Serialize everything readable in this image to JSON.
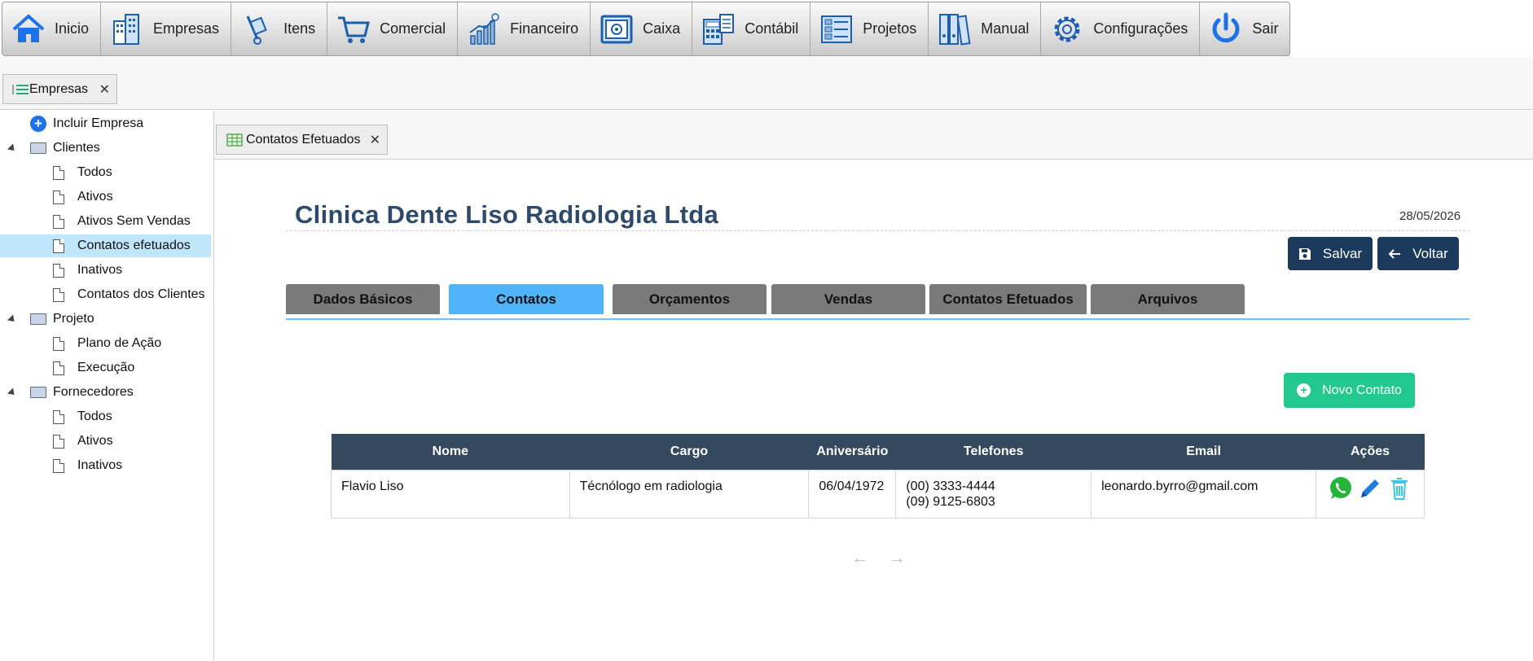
{
  "menubar": {
    "items": [
      {
        "label": "Inicio",
        "icon": "home-icon"
      },
      {
        "label": "Empresas",
        "icon": "buildings-icon"
      },
      {
        "label": "Itens",
        "icon": "hand-truck-icon"
      },
      {
        "label": "Comercial",
        "icon": "shopping-cart-icon"
      },
      {
        "label": "Financeiro",
        "icon": "finance-chart-icon"
      },
      {
        "label": "Caixa",
        "icon": "safe-icon"
      },
      {
        "label": "Contábil",
        "icon": "calculator-icon"
      },
      {
        "label": "Projetos",
        "icon": "project-board-icon"
      },
      {
        "label": "Manual",
        "icon": "binders-icon"
      },
      {
        "label": "Configurações",
        "icon": "gear-icon"
      },
      {
        "label": "Sair",
        "icon": "power-icon"
      }
    ]
  },
  "outer_tab": {
    "label": "Empresas",
    "close": "✕"
  },
  "tree": {
    "include": "Incluir Empresa",
    "groups": [
      {
        "label": "Clientes",
        "items": [
          "Todos",
          "Ativos",
          "Ativos Sem Vendas",
          "Contatos efetuados",
          "Inativos",
          "Contatos dos Clientes"
        ]
      },
      {
        "label": "Projeto",
        "items": [
          "Plano de Ação",
          "Execução"
        ]
      },
      {
        "label": "Fornecedores",
        "items": [
          "Todos",
          "Ativos",
          "Inativos"
        ]
      }
    ],
    "selected": "Contatos efetuados"
  },
  "inner_tab": {
    "label": "Contatos Efetuados",
    "close": "✕"
  },
  "page": {
    "company": "Clinica Dente Liso Radiologia Ltda",
    "date": "28/05/2026",
    "save_label": "Salvar",
    "back_label": "Voltar"
  },
  "tabs": [
    "Dados Básicos",
    "Contatos",
    "Orçamentos",
    "Vendas",
    "Contatos Efetuados",
    "Arquivos"
  ],
  "active_tab": "Contatos",
  "new_contact_label": "Novo Contato",
  "table": {
    "headers": [
      "Nome",
      "Cargo",
      "Aniversário",
      "Telefones",
      "Email",
      "Ações"
    ],
    "rows": [
      {
        "nome": "Flavio Liso",
        "cargo": "Técnólogo em radiologia",
        "aniversario": "06/04/1972",
        "telefone1": "(00) 3333-4444",
        "telefone2": "(09) 9125-6803",
        "email": "leonardo.byrro@gmail.com"
      }
    ]
  },
  "pager": {
    "prev": "←",
    "next": "→"
  },
  "colors": {
    "nav_dark": "#1b3a5c",
    "tab_active": "#4fb4f9",
    "tab_inactive": "#7a7a7a",
    "green": "#22c88e",
    "header": "#34495e",
    "title": "#2e4a6b"
  }
}
